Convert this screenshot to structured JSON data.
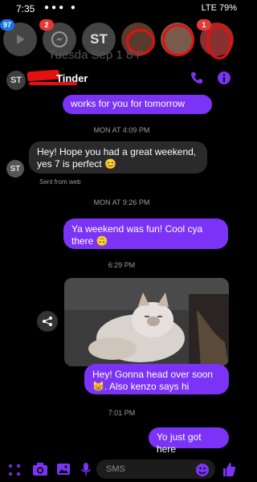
{
  "status": {
    "time": "7:35",
    "notif_dots": "●●● ●",
    "right": "LTE 79%"
  },
  "bubbles": {
    "items": [
      {
        "badge": "97",
        "badge_color": "#1a73e8",
        "label": ""
      },
      {
        "badge": "2",
        "badge_color": "#e53935",
        "label": ""
      },
      {
        "badge": "",
        "badge_color": "",
        "label": "ST"
      },
      {
        "badge": "",
        "badge_color": "",
        "label": ""
      },
      {
        "badge": "",
        "badge_color": "",
        "label": ""
      },
      {
        "badge": "1",
        "badge_color": "#e53935",
        "label": ""
      }
    ]
  },
  "header": {
    "avatar": "ST",
    "name": "Tinder",
    "faded_date": "Tuesda   Sep 1   8 P"
  },
  "messages": {
    "m0": "works for you for tomorrow",
    "ts1": "MON AT 4:09 PM",
    "m1": "Hey! Hope you had a great weekend, yes 7 is perfect 😊",
    "m1_meta": "Sent from web",
    "ts2": "MON AT 9:26 PM",
    "m2": "Ya weekend was fun! Cool cya there 🙃",
    "ts3": "6:29 PM",
    "m3": "Hey! Gonna head over soon 😸. Also kenzo says hi",
    "ts4": "7:01 PM",
    "m4": "Yo just got here"
  },
  "composer": {
    "placeholder": "SMS"
  },
  "colors": {
    "accent": "#7b33f5",
    "redaction": "#e51010"
  }
}
